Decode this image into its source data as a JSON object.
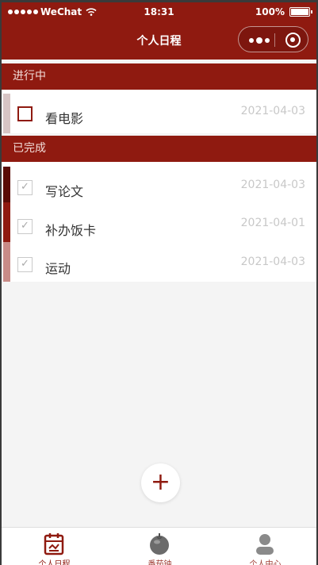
{
  "status_bar": {
    "carrier": "WeChat",
    "time": "18:31",
    "battery": "100%"
  },
  "nav": {
    "title": "个人日程"
  },
  "sections": {
    "ongoing_label": "进行中",
    "done_label": "已完成"
  },
  "tasks": {
    "ongoing": [
      {
        "name": "看电影",
        "date": "2021-04-03"
      }
    ],
    "done": [
      {
        "name": "写论文",
        "date": "2021-04-03"
      },
      {
        "name": "补办饭卡",
        "date": "2021-04-01"
      },
      {
        "name": "运动",
        "date": "2021-04-03"
      }
    ]
  },
  "fab": {
    "label": "+"
  },
  "tab_bar": {
    "items": [
      {
        "label": "个人日程",
        "icon": "calendar-icon"
      },
      {
        "label": "番茄钟",
        "icon": "tomato-icon"
      },
      {
        "label": "个人中心",
        "icon": "user-icon"
      }
    ]
  },
  "colors": {
    "brand": "#8f1a10",
    "bar_ongoing": "#d7c4c4",
    "bar_done_1": "#5a0c06",
    "bar_done_2": "#8f1a10",
    "bar_done_3": "#c98b87"
  }
}
